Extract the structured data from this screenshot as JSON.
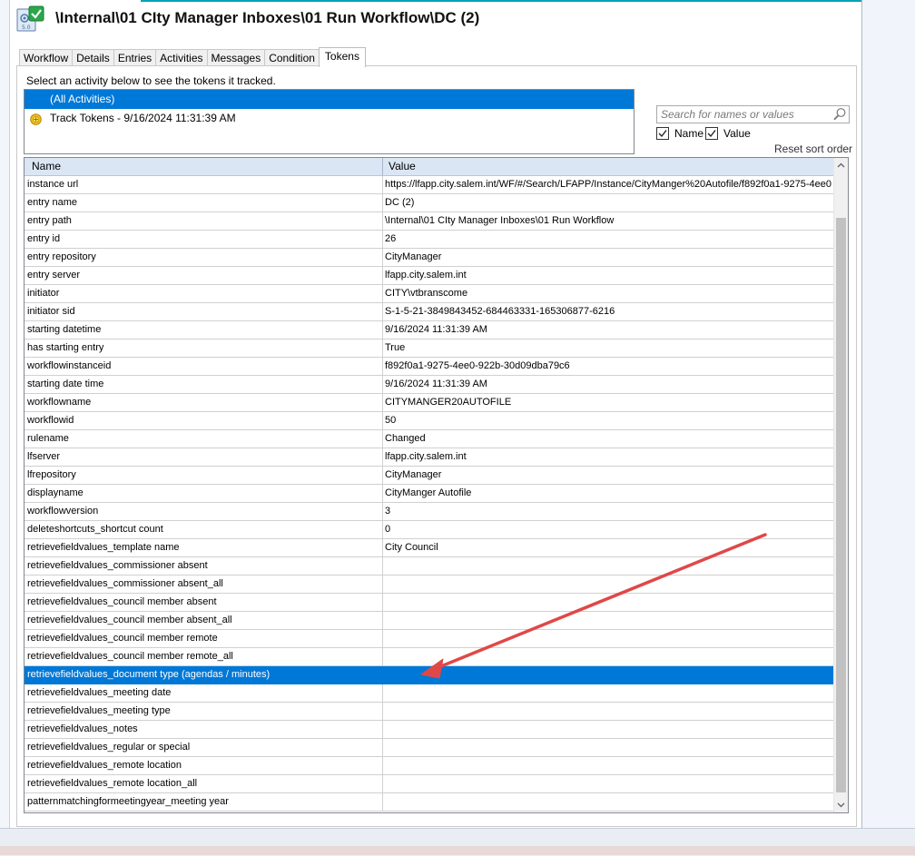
{
  "window": {
    "title": "\\Internal\\01 CIty Manager Inboxes\\01 Run Workflow\\DC (2)"
  },
  "tabs": [
    {
      "label": "Workflow"
    },
    {
      "label": "Details"
    },
    {
      "label": "Entries"
    },
    {
      "label": "Activities"
    },
    {
      "label": "Messages"
    },
    {
      "label": "Condition"
    },
    {
      "label": "Tokens",
      "active": true
    }
  ],
  "tokens_panel": {
    "instruction": "Select an activity below to see the tokens it tracked.",
    "activities": [
      {
        "label": "(All Activities)",
        "selected": true,
        "icon": ""
      },
      {
        "label": "Track Tokens - 9/16/2024 11:31:39 AM",
        "selected": false,
        "icon": "track-tokens-icon"
      }
    ],
    "search": {
      "placeholder": "Search for names or values"
    },
    "filters": {
      "name_label": "Name",
      "name_checked": true,
      "value_label": "Value",
      "value_checked": true
    },
    "reset_sort_label": "Reset sort order",
    "grid": {
      "columns": [
        "Name",
        "Value"
      ],
      "rows": [
        {
          "name": "instance url",
          "value": "https://lfapp.city.salem.int/WF/#/Search/LFAPP/Instance/CityManger%20Autofile/f892f0a1-9275-4ee0"
        },
        {
          "name": "entry name",
          "value": "DC (2)"
        },
        {
          "name": "entry path",
          "value": "\\Internal\\01 CIty Manager Inboxes\\01 Run Workflow"
        },
        {
          "name": "entry id",
          "value": "26"
        },
        {
          "name": "entry repository",
          "value": "CityManager"
        },
        {
          "name": "entry server",
          "value": "lfapp.city.salem.int"
        },
        {
          "name": "initiator",
          "value": "CITY\\vtbranscome"
        },
        {
          "name": "initiator sid",
          "value": "S-1-5-21-3849843452-684463331-165306877-6216"
        },
        {
          "name": "starting datetime",
          "value": "9/16/2024 11:31:39 AM"
        },
        {
          "name": "has starting entry",
          "value": "True"
        },
        {
          "name": "workflowinstanceid",
          "value": "f892f0a1-9275-4ee0-922b-30d09dba79c6"
        },
        {
          "name": "starting date time",
          "value": "9/16/2024 11:31:39 AM"
        },
        {
          "name": "workflowname",
          "value": "CITYMANGER20AUTOFILE"
        },
        {
          "name": "workflowid",
          "value": "50"
        },
        {
          "name": "rulename",
          "value": "Changed"
        },
        {
          "name": "lfserver",
          "value": "lfapp.city.salem.int"
        },
        {
          "name": "lfrepository",
          "value": "CityManager"
        },
        {
          "name": "displayname",
          "value": "CityManger Autofile"
        },
        {
          "name": "workflowversion",
          "value": "3"
        },
        {
          "name": "deleteshortcuts_shortcut count",
          "value": "0"
        },
        {
          "name": "retrievefieldvalues_template name",
          "value": "City Council"
        },
        {
          "name": "retrievefieldvalues_commissioner absent",
          "value": ""
        },
        {
          "name": "retrievefieldvalues_commissioner absent_all",
          "value": ""
        },
        {
          "name": "retrievefieldvalues_council member absent",
          "value": ""
        },
        {
          "name": "retrievefieldvalues_council member absent_all",
          "value": ""
        },
        {
          "name": "retrievefieldvalues_council member remote",
          "value": ""
        },
        {
          "name": "retrievefieldvalues_council member remote_all",
          "value": ""
        },
        {
          "name": "retrievefieldvalues_document type (agendas / minutes)",
          "value": "",
          "selected": true
        },
        {
          "name": "retrievefieldvalues_meeting date",
          "value": ""
        },
        {
          "name": "retrievefieldvalues_meeting type",
          "value": ""
        },
        {
          "name": "retrievefieldvalues_notes",
          "value": ""
        },
        {
          "name": "retrievefieldvalues_regular or special",
          "value": ""
        },
        {
          "name": "retrievefieldvalues_remote location",
          "value": ""
        },
        {
          "name": "retrievefieldvalues_remote location_all",
          "value": ""
        },
        {
          "name": "patternmatchingformeetingyear_meeting year",
          "value": ""
        }
      ]
    }
  },
  "colors": {
    "selection": "#0078d7",
    "header_bg": "#dbe6f4",
    "annotation_arrow": "#e04848"
  }
}
